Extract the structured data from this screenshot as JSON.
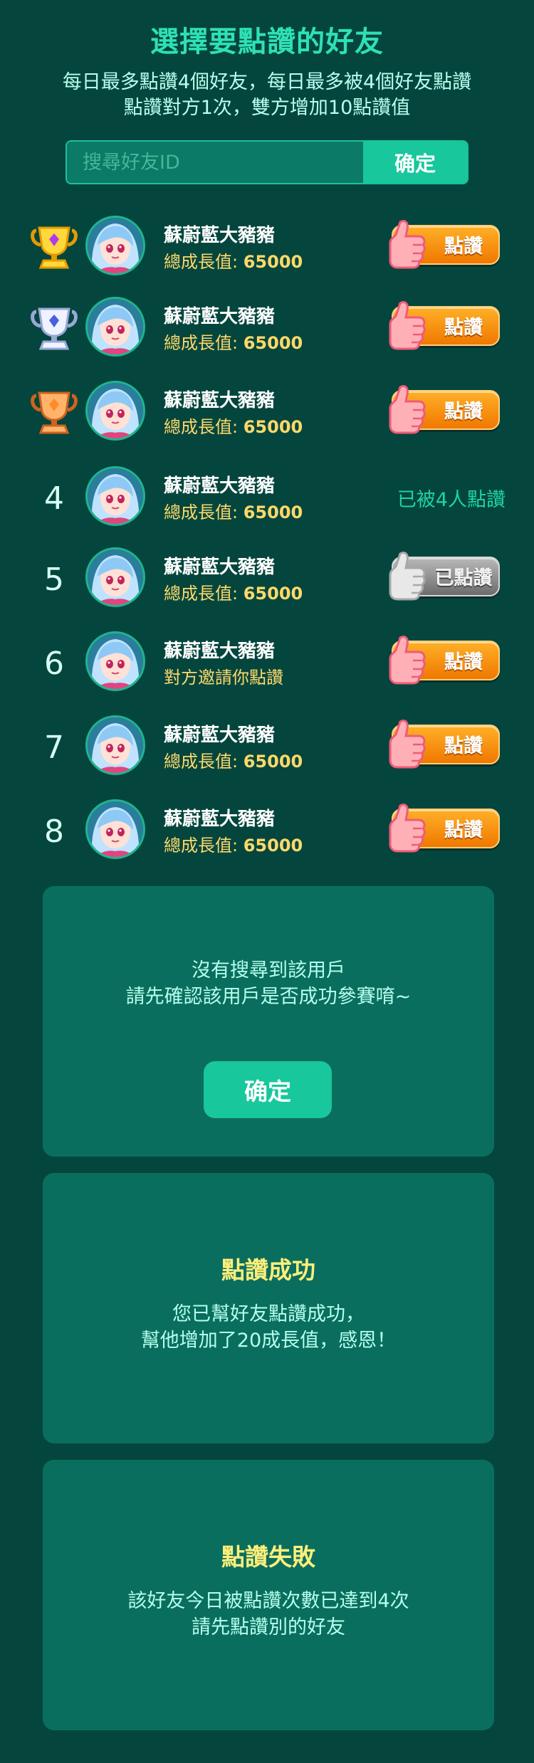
{
  "header": {
    "title": "選擇要點讚的好友",
    "subtitle_line1": "每日最多點讚4個好友，每日最多被4個好友點讚",
    "subtitle_line2": "點讚對方1次，雙方增加10點讚值"
  },
  "search": {
    "placeholder": "搜尋好友ID",
    "value": "",
    "confirm_label": "确定"
  },
  "friends": [
    {
      "rank": "",
      "rank_icon": "gold-trophy-icon",
      "name": "蘇蔚藍大豬豬",
      "sub_label": "總成長值: ",
      "sub_value": "65000",
      "action": "button",
      "action_label": "點讚",
      "button_style": "orange"
    },
    {
      "rank": "",
      "rank_icon": "silver-trophy-icon",
      "name": "蘇蔚藍大豬豬",
      "sub_label": "總成長值: ",
      "sub_value": "65000",
      "action": "button",
      "action_label": "點讚",
      "button_style": "orange"
    },
    {
      "rank": "",
      "rank_icon": "bronze-trophy-icon",
      "name": "蘇蔚藍大豬豬",
      "sub_label": "總成長值: ",
      "sub_value": "65000",
      "action": "button",
      "action_label": "點讚",
      "button_style": "orange"
    },
    {
      "rank": "4",
      "rank_icon": "",
      "name": "蘇蔚藍大豬豬",
      "sub_label": "總成長值: ",
      "sub_value": "65000",
      "action": "text",
      "action_label": "已被4人點讚",
      "button_style": ""
    },
    {
      "rank": "5",
      "rank_icon": "",
      "name": "蘇蔚藍大豬豬",
      "sub_label": "總成長值: ",
      "sub_value": "65000",
      "action": "button",
      "action_label": "已點讚",
      "button_style": "gray"
    },
    {
      "rank": "6",
      "rank_icon": "",
      "name": "蘇蔚藍大豬豬",
      "sub_label": "對方邀請你點讚",
      "sub_value": "",
      "action": "button",
      "action_label": "點讚",
      "button_style": "orange"
    },
    {
      "rank": "7",
      "rank_icon": "",
      "name": "蘇蔚藍大豬豬",
      "sub_label": "總成長值: ",
      "sub_value": "65000",
      "action": "button",
      "action_label": "點讚",
      "button_style": "orange"
    },
    {
      "rank": "8",
      "rank_icon": "",
      "name": "蘇蔚藍大豬豬",
      "sub_label": "總成長值: ",
      "sub_value": "65000",
      "action": "button",
      "action_label": "點讚",
      "button_style": "orange"
    }
  ],
  "not_found_dialog": {
    "line1": "沒有搜尋到該用戶",
    "line2": "請先確認該用戶是否成功參賽唷~",
    "confirm_label": "确定"
  },
  "success_dialog": {
    "title": "點讚成功",
    "line1": "您已幫好友點讚成功，",
    "line2": "幫他增加了20成長值，感恩！"
  },
  "fail_dialog": {
    "title": "點讚失敗",
    "line1": "該好友今日被點讚次數已達到4次",
    "line2": "請先點讚別的好友"
  },
  "colors": {
    "background": "#04463d",
    "accent": "#19c79d",
    "title": "#2fe0b5",
    "gold_text": "#ffd86b",
    "like_button": "#f08a00"
  }
}
